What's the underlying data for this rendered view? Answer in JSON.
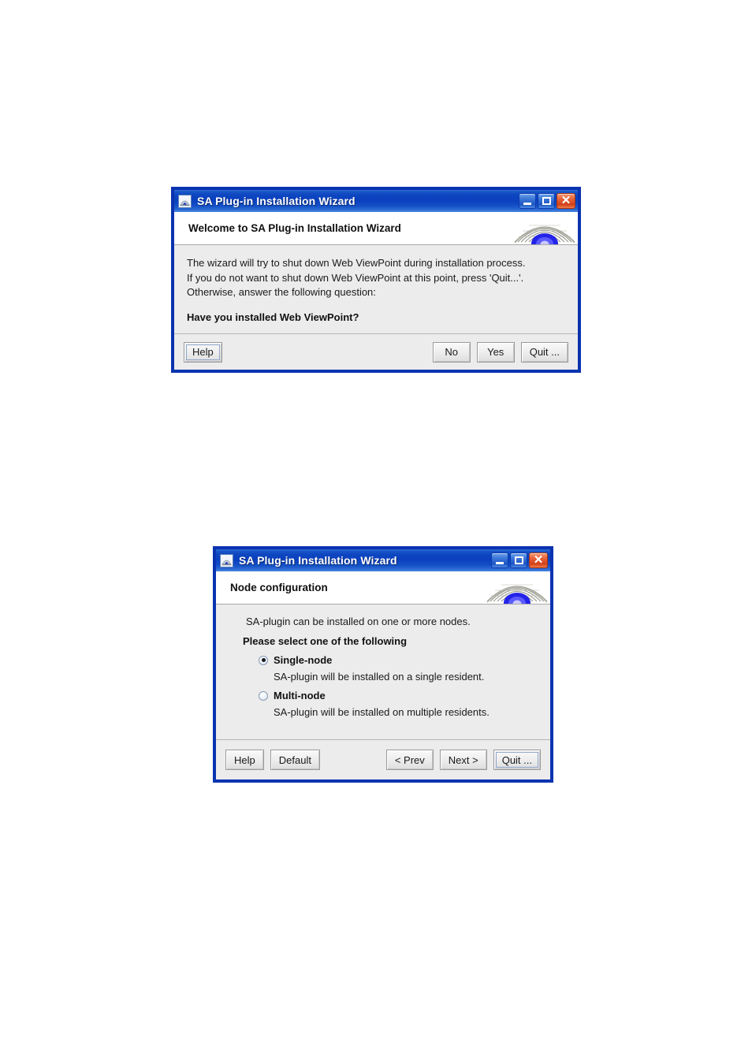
{
  "page": {
    "background": "#FFFFFF",
    "accent_blue": "#0A33B0",
    "body_gray": "#ECECEC",
    "close_red": "#D2401A"
  },
  "dialogs": [
    {
      "id": "welcome",
      "titlebar": {
        "title": "SA Plug-in Installation Wizard",
        "icon": "dome-app-icon",
        "minimize_label": "Minimize",
        "maximize_label": "Maximize",
        "close_label": "Close"
      },
      "header": {
        "title": "Welcome to  SA Plug-in Installation Wizard",
        "logo": "dome-logo"
      },
      "body": {
        "lines": [
          "The wizard will try to shut down Web ViewPoint during installation process.",
          "If you do not want to shut down Web ViewPoint at this point, press 'Quit...'.",
          "Otherwise, answer the following question:"
        ],
        "question": "Have you installed Web ViewPoint?"
      },
      "buttons": {
        "help": "Help",
        "no": "No",
        "yes": "Yes",
        "quit": "Quit ..."
      }
    },
    {
      "id": "node-configuration",
      "titlebar": {
        "title": "SA Plug-in Installation Wizard",
        "icon": "dome-app-icon",
        "minimize_label": "Minimize",
        "maximize_label": "Maximize",
        "close_label": "Close"
      },
      "header": {
        "title": "Node configuration",
        "logo": "dome-logo"
      },
      "body": {
        "intro": "SA-plugin can be installed on one or more nodes.",
        "prompt": "Please select one of the following",
        "options": [
          {
            "label": "Single-node",
            "description": "SA-plugin will be installed on a single resident.",
            "selected": true
          },
          {
            "label": "Multi-node",
            "description": "SA-plugin will be installed on multiple residents.",
            "selected": false
          }
        ]
      },
      "buttons": {
        "help": "Help",
        "default": "Default",
        "prev": "< Prev",
        "next": "Next >",
        "quit": "Quit ..."
      }
    }
  ]
}
